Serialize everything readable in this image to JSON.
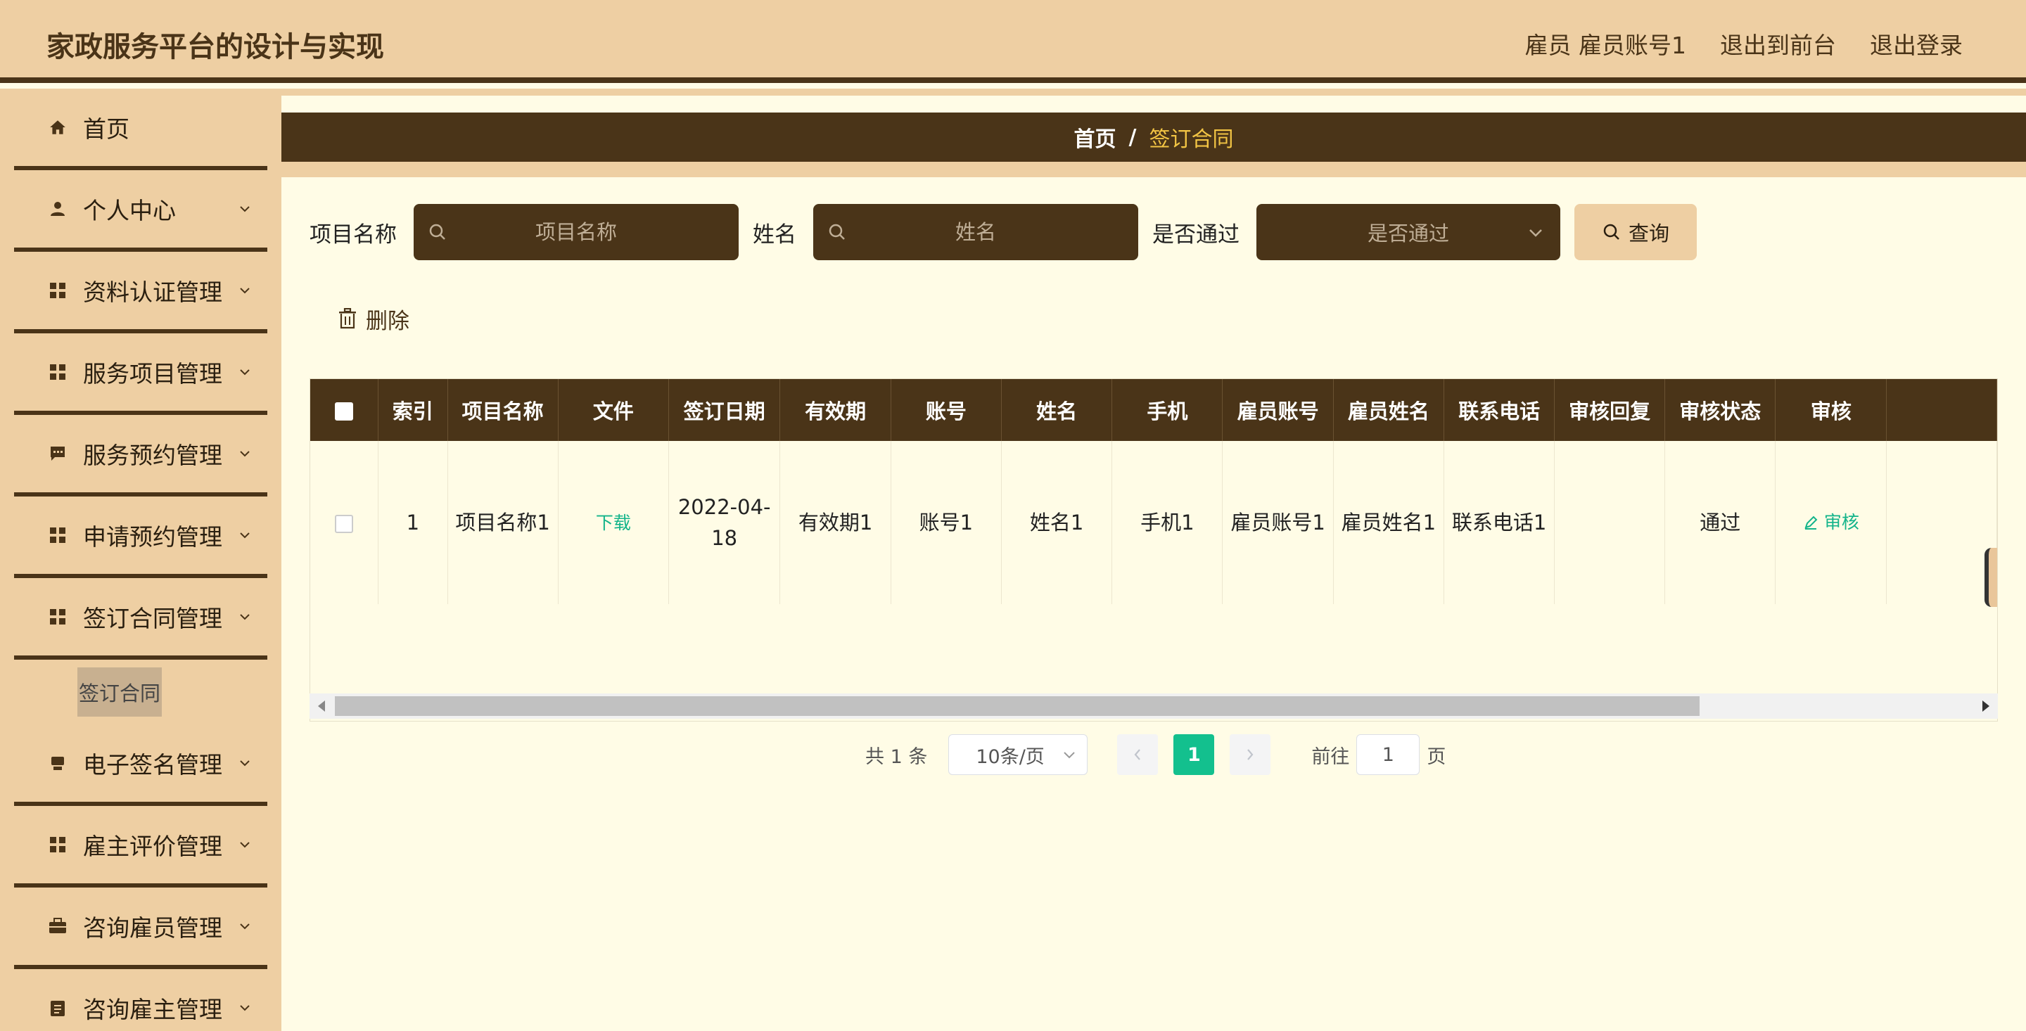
{
  "header": {
    "title": "家政服务平台的设计与实现",
    "user_info": "雇员 雇员账号1",
    "to_front_label": "退出到前台",
    "logout_label": "退出登录"
  },
  "sidebar": {
    "items": [
      {
        "label": "首页",
        "icon": "home-icon"
      },
      {
        "label": "个人中心",
        "icon": "user-icon"
      },
      {
        "label": "资料认证管理",
        "icon": "grid-icon"
      },
      {
        "label": "服务项目管理",
        "icon": "grid-icon"
      },
      {
        "label": "服务预约管理",
        "icon": "chat-icon"
      },
      {
        "label": "申请预约管理",
        "icon": "grid-icon"
      },
      {
        "label": "签订合同管理",
        "icon": "grid-icon"
      },
      {
        "label": "电子签名管理",
        "icon": "stamp-icon"
      },
      {
        "label": "雇主评价管理",
        "icon": "grid-icon"
      },
      {
        "label": "咨询雇员管理",
        "icon": "briefcase-icon"
      },
      {
        "label": "咨询雇主管理",
        "icon": "clipboard-icon"
      }
    ],
    "subitem": "签订合同"
  },
  "breadcrumb": {
    "home": "首页",
    "separator": "/",
    "current": "签订合同"
  },
  "search": {
    "project_label": "项目名称",
    "project_placeholder": "项目名称",
    "name_label": "姓名",
    "name_placeholder": "姓名",
    "pass_label": "是否通过",
    "pass_placeholder": "是否通过",
    "query_label": "查询"
  },
  "actions": {
    "delete_label": "删除"
  },
  "table": {
    "headers": [
      "索引",
      "项目名称",
      "文件",
      "签订日期",
      "有效期",
      "账号",
      "姓名",
      "手机",
      "雇员账号",
      "雇员姓名",
      "联系电话",
      "审核回复",
      "审核状态",
      "审核"
    ],
    "rows": [
      {
        "index": "1",
        "project": "项目名称1",
        "file": "下载",
        "date": "2022-04-18",
        "validity": "有效期1",
        "account": "账号1",
        "name": "姓名1",
        "phone": "手机1",
        "emp_account": "雇员账号1",
        "emp_name": "雇员姓名1",
        "contact": "联系电话1",
        "reply": "",
        "status": "通过",
        "audit": "审核"
      }
    ]
  },
  "pagination": {
    "total": "共 1 条",
    "page_size": "10条/页",
    "current_page": "1",
    "goto_label": "前往",
    "goto_value": "1",
    "page_suffix": "页"
  },
  "colors": {
    "brand_dark": "#4a3418",
    "brand_light": "#eecfa3",
    "background": "#fffce6",
    "accent_green": "#13c08e",
    "breadcrumb_current": "#f3c544"
  }
}
